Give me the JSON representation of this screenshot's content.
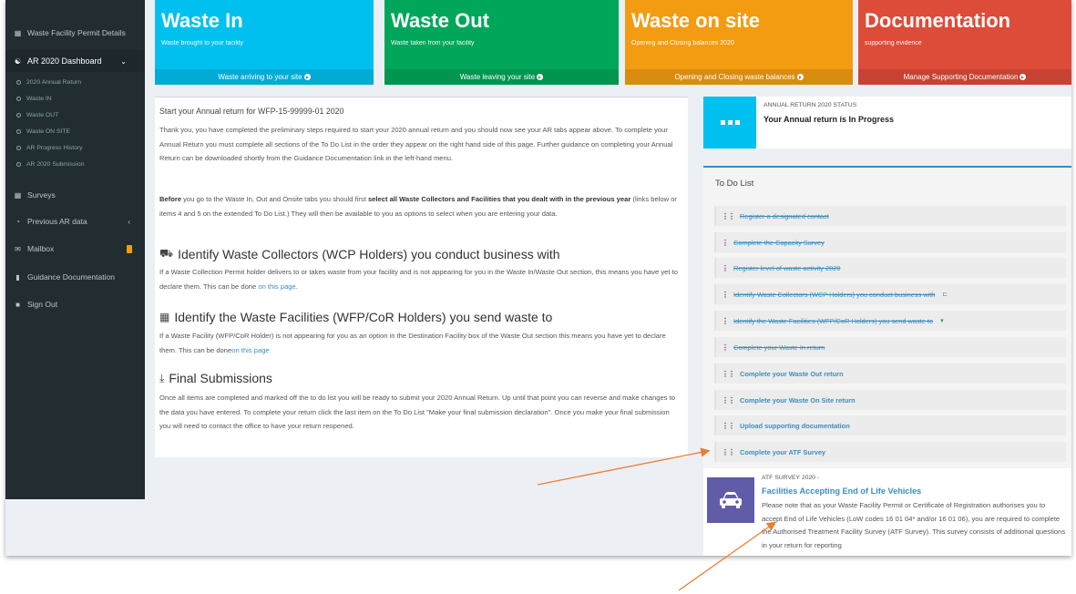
{
  "colors": {
    "sidebar_bg": "#222d32",
    "waste_in": "#00c0ef",
    "waste_out": "#00a65a",
    "waste_on_site": "#f39c12",
    "documentation": "#dd4b39",
    "status_icon": "#00c0ef",
    "atf_icon": "#605ca8",
    "link": "#3c8dbc",
    "annotation_arrow": "#ed7d31"
  },
  "sidebar": {
    "items": [
      {
        "label": "Waste Facility Permit Details",
        "icon": "table-icon"
      },
      {
        "label": "AR 2020 Dashboard",
        "icon": "dashboard-icon"
      }
    ],
    "sub_items": [
      "2020 Annual Return",
      "Waste IN",
      "Waste OUT",
      "Waste ON SITE",
      "AR Progress History",
      "AR 2020 Submission"
    ],
    "items2": [
      {
        "label": "Surveys",
        "icon": "grid-icon"
      },
      {
        "label": "Previous AR data",
        "icon": "pie-chart-icon"
      },
      {
        "label": "Mailbox",
        "icon": "envelope-icon"
      },
      {
        "label": "Guidance Documentation",
        "icon": "book-icon"
      },
      {
        "label": "Sign Out",
        "icon": "lock-icon"
      }
    ]
  },
  "tiles": [
    {
      "title": "Waste In",
      "subtitle": "Waste brought to your facility",
      "footer": "Waste arriving to your site"
    },
    {
      "title": "Waste Out",
      "subtitle": "Waste taken from your facility",
      "footer": "Waste leaving your site"
    },
    {
      "title": "Waste on site",
      "subtitle": "Opening and Closing balances 2020",
      "footer": "Opening and Closing waste balances"
    },
    {
      "title": "Documentation",
      "subtitle": "supporting evidence",
      "footer": "Manage Supporting Documentation"
    }
  ],
  "main": {
    "title": "Start your Annual return for WFP-15-99999-01 2020",
    "intro": "Thank you, you have completed the preliminary steps required to start your 2020 annual return and you should now see your AR tabs appear above.  To complete your Annual Return you must complete all sections of the To Do List in the order they appear on the right hand side of this page.  Further guidance on completing your Annual Return can be downloaded shortly from the Guidance Documentation link in the left-hand menu.",
    "before_bold": "Before",
    "before_mid": " you go to the Waste In, Out and Onsite tabs you should first ",
    "before_bold2": "select all Waste Collectors and Facilities that you dealt with in the previous year",
    "before_rest": " (links below or items 4 and 5 on the extended To Do List.) They will then be available to you as options to select when you are entering your data.",
    "collectors_heading": "Identify Waste Collectors (WCP Holders) you conduct business with",
    "collectors_text": "If a Waste Collection Permit holder delivers to or takes waste from your facility and is not appearing for you in the Waste In/Waste Out section, this means you have yet to declare them. This can be done ",
    "collectors_link": "on this page",
    "collectors_end": ".",
    "facilities_heading": "Identify the Waste Facilities (WFP/CoR Holders) you send waste to",
    "facilities_text": "If a Waste Facility (WFP/CoR Holder) is not appearing for you as an option in the Destination Facility box of the Waste Out section this means you have yet to declare them. This can be done",
    "facilities_link": "on this page",
    "final_heading": "Final Submissions",
    "final_text": "Once all items are completed and marked off the to do list you will be ready to submit your 2020 Annual Return. Up until that point you can reverse and make changes to the data you have entered. To complete your return click the last item on the To Do List \"Make your final submission declaration\". Once you make your final submission you will need to contact the office to have your return reopened."
  },
  "status": {
    "label": "ANNUAL RETURN 2020 STATUS",
    "text": "Your Annual return is In Progress"
  },
  "todo": {
    "heading": "To Do List",
    "items": [
      {
        "label": "Register a designated contact",
        "done": true
      },
      {
        "label": "Complete the Capacity Survey",
        "done": true
      },
      {
        "label": "Register level of waste activity 2020",
        "done": true
      },
      {
        "label": "Identify Waste Collectors (WCP Holders) you conduct business with",
        "done": true
      },
      {
        "label": "Identify the Waste Facilities (WFP/CoR Holders) you send waste to",
        "done": true
      },
      {
        "label": "Complete your Waste In return",
        "done": true
      },
      {
        "label": "Complete your Waste Out return",
        "done": false
      },
      {
        "label": "Complete your Waste On Site return",
        "done": false
      },
      {
        "label": "Upload supporting documentation",
        "done": false
      },
      {
        "label": "Complete your ATF Survey",
        "done": false
      }
    ]
  },
  "atf": {
    "label": "ATF SURVEY 2020 -",
    "title": "Facilities Accepting End of Life Vehicles",
    "text": "Please note that as your Waste Facility Permit or Certificate of Registration authorises you to accept End of Life Vehicles (LoW codes 16 01 04* and/or 16 01 06), you are required to complete the Authorised Treatment Facility Survey (ATF Survey). This survey consists of additional questions in your return for reporting"
  }
}
